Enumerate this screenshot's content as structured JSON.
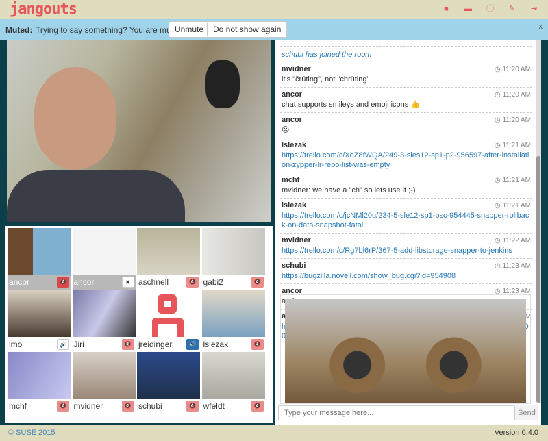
{
  "app": {
    "logo": "jangouts",
    "icons": [
      "video-camera-icon",
      "screen-share-icon",
      "info-icon",
      "pin-icon",
      "sign-out-icon"
    ]
  },
  "alert": {
    "label": "Muted:",
    "message": "Trying to say something? You are muted.",
    "unmute": "Unmute",
    "dismiss": "Do not show again",
    "close": "x"
  },
  "feeds": [
    {
      "name": "ancor",
      "state": "muted-local"
    },
    {
      "name": "ancor",
      "state": "screen-close"
    },
    {
      "name": "aschnell",
      "state": "muted"
    },
    {
      "name": "gabi2",
      "state": "muted"
    },
    {
      "name": "lmo",
      "state": "unmuted"
    },
    {
      "name": "Jiri",
      "state": "muted"
    },
    {
      "name": "jreidinger",
      "state": "speaking"
    },
    {
      "name": "lslezak",
      "state": "muted"
    },
    {
      "name": "mchf",
      "state": "muted"
    },
    {
      "name": "mvidner",
      "state": "muted"
    },
    {
      "name": "schubi",
      "state": "muted"
    },
    {
      "name": "wfeldt",
      "state": "muted"
    }
  ],
  "chat": {
    "system": "schubi has joined the room",
    "messages": [
      {
        "user": "mvidner",
        "time": "11:20 AM",
        "text": "it's \"črūting\", not \"chrūting\""
      },
      {
        "user": "ancor",
        "time": "11:20 AM",
        "text": "chat supports smileys and emoji icons 👍"
      },
      {
        "user": "ancor",
        "time": "11:20 AM",
        "text": "☹"
      },
      {
        "user": "lslezak",
        "time": "11:21 AM",
        "link": "https://trello.com/c/XoZ8fWQA/249-3-sles12-sp1-p2-956597-after-installation-zypper-lr-repo-list-was-empty"
      },
      {
        "user": "mchf",
        "time": "11:21 AM",
        "text": "mvidner: we have a \"ch\" so lets use it ;-)"
      },
      {
        "user": "lslezak",
        "time": "11:21 AM",
        "link": "https://trello.com/c/jcNMl20u/234-5-sle12-sp1-bsc-954445-snapper-rollback-on-data-snapshot-fatal"
      },
      {
        "user": "mvidner",
        "time": "11:22 AM",
        "link": "https://trello.com/c/Rg7bl6rP/367-5-add-libstorage-snapper-to-jenkins"
      },
      {
        "user": "schubi",
        "time": "11:23 AM",
        "link": "https://bugzilla.novell.com/show_bug.cgi?id=954908"
      },
      {
        "user": "ancor",
        "time": "11:23 AM",
        "text": "and images"
      },
      {
        "user": "ancor",
        "time": "11:23 AM",
        "link": "https://pbs.twimg.com/profile_images/551143684671291392/Nx_lx21L_400x400.jpeg"
      }
    ],
    "placeholder": "Type your message here...",
    "send": "Send"
  },
  "footer": {
    "copyright": "© SUSE 2015",
    "version": "Version 0.4.0"
  },
  "colors": {
    "accent": "#e5555a",
    "header_bg": "#e0dcbe",
    "alert_bg": "#9fd3ea",
    "body_bg": "#0b3f4a",
    "link": "#2a7ab8"
  }
}
